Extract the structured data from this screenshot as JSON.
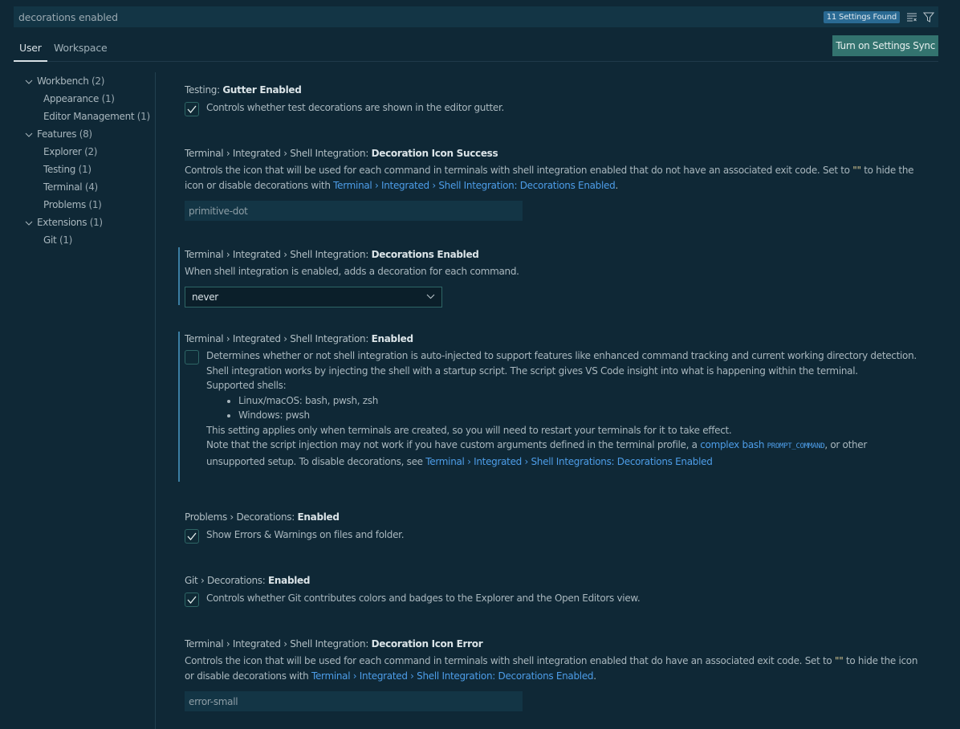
{
  "search": {
    "value": "decorations enabled",
    "results_badge": "11 Settings Found",
    "clear_filter_icon": "clear-filter-icon",
    "filter_icon": "filter-icon"
  },
  "tabs": {
    "user": "User",
    "workspace": "Workspace",
    "active": "User"
  },
  "sync_button": "Turn on Settings Sync",
  "toc": [
    {
      "label": "Workbench",
      "count": "(2)",
      "expanded": true,
      "level": 0
    },
    {
      "label": "Appearance",
      "count": "(1)",
      "level": 1
    },
    {
      "label": "Editor Management",
      "count": "(1)",
      "level": 1
    },
    {
      "label": "Features",
      "count": "(8)",
      "expanded": true,
      "level": 0
    },
    {
      "label": "Explorer",
      "count": "(2)",
      "level": 1
    },
    {
      "label": "Testing",
      "count": "(1)",
      "level": 1
    },
    {
      "label": "Terminal",
      "count": "(4)",
      "level": 1
    },
    {
      "label": "Problems",
      "count": "(1)",
      "level": 1
    },
    {
      "label": "Extensions",
      "count": "(1)",
      "expanded": true,
      "level": 0
    },
    {
      "label": "Git",
      "count": "(1)",
      "level": 1
    }
  ],
  "settings": {
    "testing_gutter": {
      "category": "Testing: ",
      "key": "Gutter Enabled",
      "checked": true,
      "description": "Controls whether test decorations are shown in the editor gutter."
    },
    "icon_success": {
      "category": "Terminal › Integrated › Shell Integration: ",
      "key": "Decoration Icon Success",
      "desc_part1": "Controls the icon that will be used for each command in terminals with shell integration enabled that do not have an associated exit code. Set to ",
      "desc_quote": "\"\"",
      "desc_part2": " to hide the icon or disable decorations with ",
      "desc_link": "Terminal › Integrated › Shell Integration: Decorations Enabled",
      "desc_end": ".",
      "value": "primitive-dot"
    },
    "decorations_enabled": {
      "category": "Terminal › Integrated › Shell Integration: ",
      "key": "Decorations Enabled",
      "description": "When shell integration is enabled, adds a decoration for each command.",
      "selected": "never"
    },
    "shell_integration_enabled": {
      "category": "Terminal › Integrated › Shell Integration: ",
      "key": "Enabled",
      "checked": false,
      "desc_line1": "Determines whether or not shell integration is auto-injected to support features like enhanced command tracking and current working directory detection.",
      "desc_line2": "Shell integration works by injecting the shell with a startup script. The script gives VS Code insight into what is happening within the terminal.",
      "desc_line3": "Supported shells:",
      "shells": [
        "Linux/macOS: bash, pwsh, zsh",
        "Windows: pwsh"
      ],
      "desc_line4": "This setting applies only when terminals are created, so you will need to restart your terminals for it to take effect.",
      "note_part1": "Note that the script injection may not work if you have custom arguments defined in the terminal profile, a ",
      "note_link": "complex bash",
      "note_code": "PROMPT_COMMAND",
      "note_part2": ", or other unsupported setup. To disable decorations, see ",
      "note_link2": "Terminal › Integrated › Shell Integrations: Decorations Enabled"
    },
    "problems_decorations": {
      "category": "Problems › Decorations: ",
      "key": "Enabled",
      "checked": true,
      "description": "Show Errors & Warnings on files and folder."
    },
    "git_decorations": {
      "category": "Git › Decorations: ",
      "key": "Enabled",
      "checked": true,
      "description": "Controls whether Git contributes colors and badges to the Explorer and the Open Editors view."
    },
    "icon_error": {
      "category": "Terminal › Integrated › Shell Integration: ",
      "key": "Decoration Icon Error",
      "desc_part1": "Controls the icon that will be used for each command in terminals with shell integration enabled that do have an associated exit code. Set to ",
      "desc_quote": "\"\"",
      "desc_part2": " to hide the icon or disable decorations with ",
      "desc_link": "Terminal › Integrated › Shell Integration: Decorations Enabled",
      "desc_end": ".",
      "value": "error-small"
    }
  }
}
